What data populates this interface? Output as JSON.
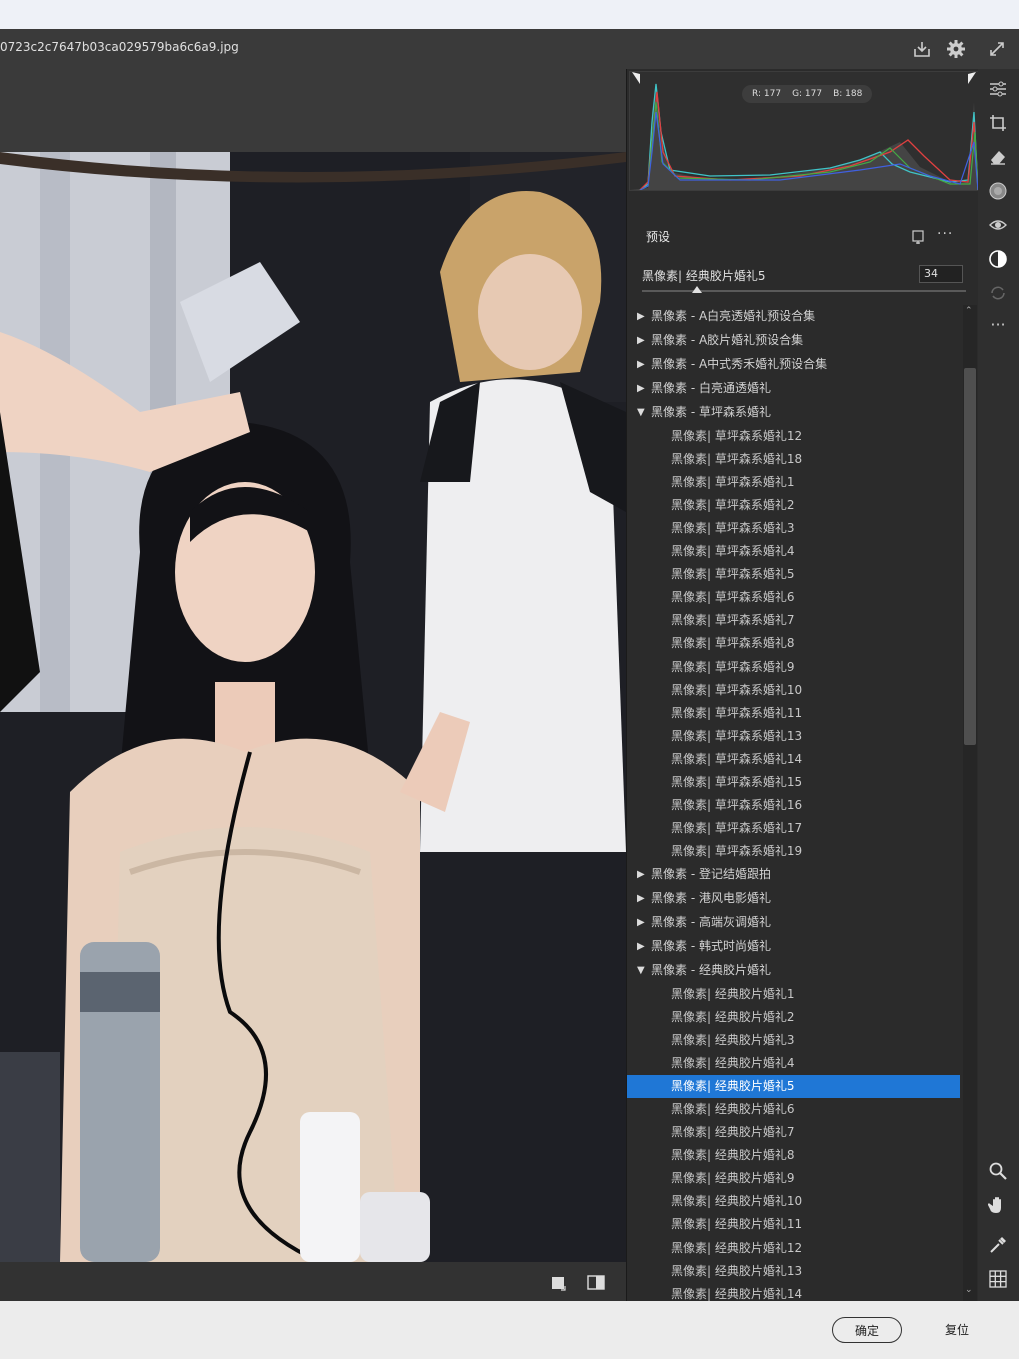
{
  "window": {
    "filename": "0723c2c7647b03ca029579ba6c6a9.jpg"
  },
  "histogram": {
    "r": "R: 177",
    "g": "G: 177",
    "b": "B: 188"
  },
  "presets": {
    "header": "预设",
    "amount_label": "黑像素| 经典胶片婚礼5",
    "amount_value": "34",
    "amount_fraction": 0.17,
    "groups": [
      {
        "label": "黑像素 - A白亮透婚礼预设合集",
        "expanded": false,
        "items": []
      },
      {
        "label": "黑像素 - A胶片婚礼预设合集",
        "expanded": false,
        "items": []
      },
      {
        "label": "黑像素 - A中式秀禾婚礼预设合集",
        "expanded": false,
        "items": []
      },
      {
        "label": "黑像素 - 白亮通透婚礼",
        "expanded": false,
        "items": []
      },
      {
        "label": "黑像素 - 草坪森系婚礼",
        "expanded": true,
        "items": [
          "黑像素|  草坪森系婚礼12",
          "黑像素|  草坪森系婚礼18",
          "黑像素| 草坪森系婚礼1",
          "黑像素| 草坪森系婚礼2",
          "黑像素| 草坪森系婚礼3",
          "黑像素| 草坪森系婚礼4",
          "黑像素| 草坪森系婚礼5",
          "黑像素| 草坪森系婚礼6",
          "黑像素| 草坪森系婚礼7",
          "黑像素| 草坪森系婚礼8",
          "黑像素| 草坪森系婚礼9",
          "黑像素| 草坪森系婚礼10",
          "黑像素| 草坪森系婚礼11",
          "黑像素| 草坪森系婚礼13",
          "黑像素| 草坪森系婚礼14",
          "黑像素| 草坪森系婚礼15",
          "黑像素| 草坪森系婚礼16",
          "黑像素| 草坪森系婚礼17",
          "黑像素| 草坪森系婚礼19"
        ]
      },
      {
        "label": "黑像素 - 登记结婚跟拍",
        "expanded": false,
        "items": []
      },
      {
        "label": "黑像素 - 港风电影婚礼",
        "expanded": false,
        "items": []
      },
      {
        "label": "黑像素 - 高端灰调婚礼",
        "expanded": false,
        "items": []
      },
      {
        "label": "黑像素 - 韩式时尚婚礼",
        "expanded": false,
        "items": []
      },
      {
        "label": "黑像素 - 经典胶片婚礼",
        "expanded": true,
        "items": [
          "黑像素| 经典胶片婚礼1",
          "黑像素| 经典胶片婚礼2",
          "黑像素| 经典胶片婚礼3",
          "黑像素| 经典胶片婚礼4",
          "黑像素| 经典胶片婚礼5",
          "黑像素| 经典胶片婚礼6",
          "黑像素| 经典胶片婚礼7",
          "黑像素| 经典胶片婚礼8",
          "黑像素| 经典胶片婚礼9",
          "黑像素| 经典胶片婚礼10",
          "黑像素| 经典胶片婚礼11",
          "黑像素| 经典胶片婚礼12",
          "黑像素| 经典胶片婚礼13",
          "黑像素| 经典胶片婚礼14"
        ]
      }
    ],
    "selected": "黑像素| 经典胶片婚礼5"
  },
  "footer": {
    "ok": "确定",
    "reset": "复位"
  },
  "colors": {
    "accent": "#1f77d6"
  }
}
